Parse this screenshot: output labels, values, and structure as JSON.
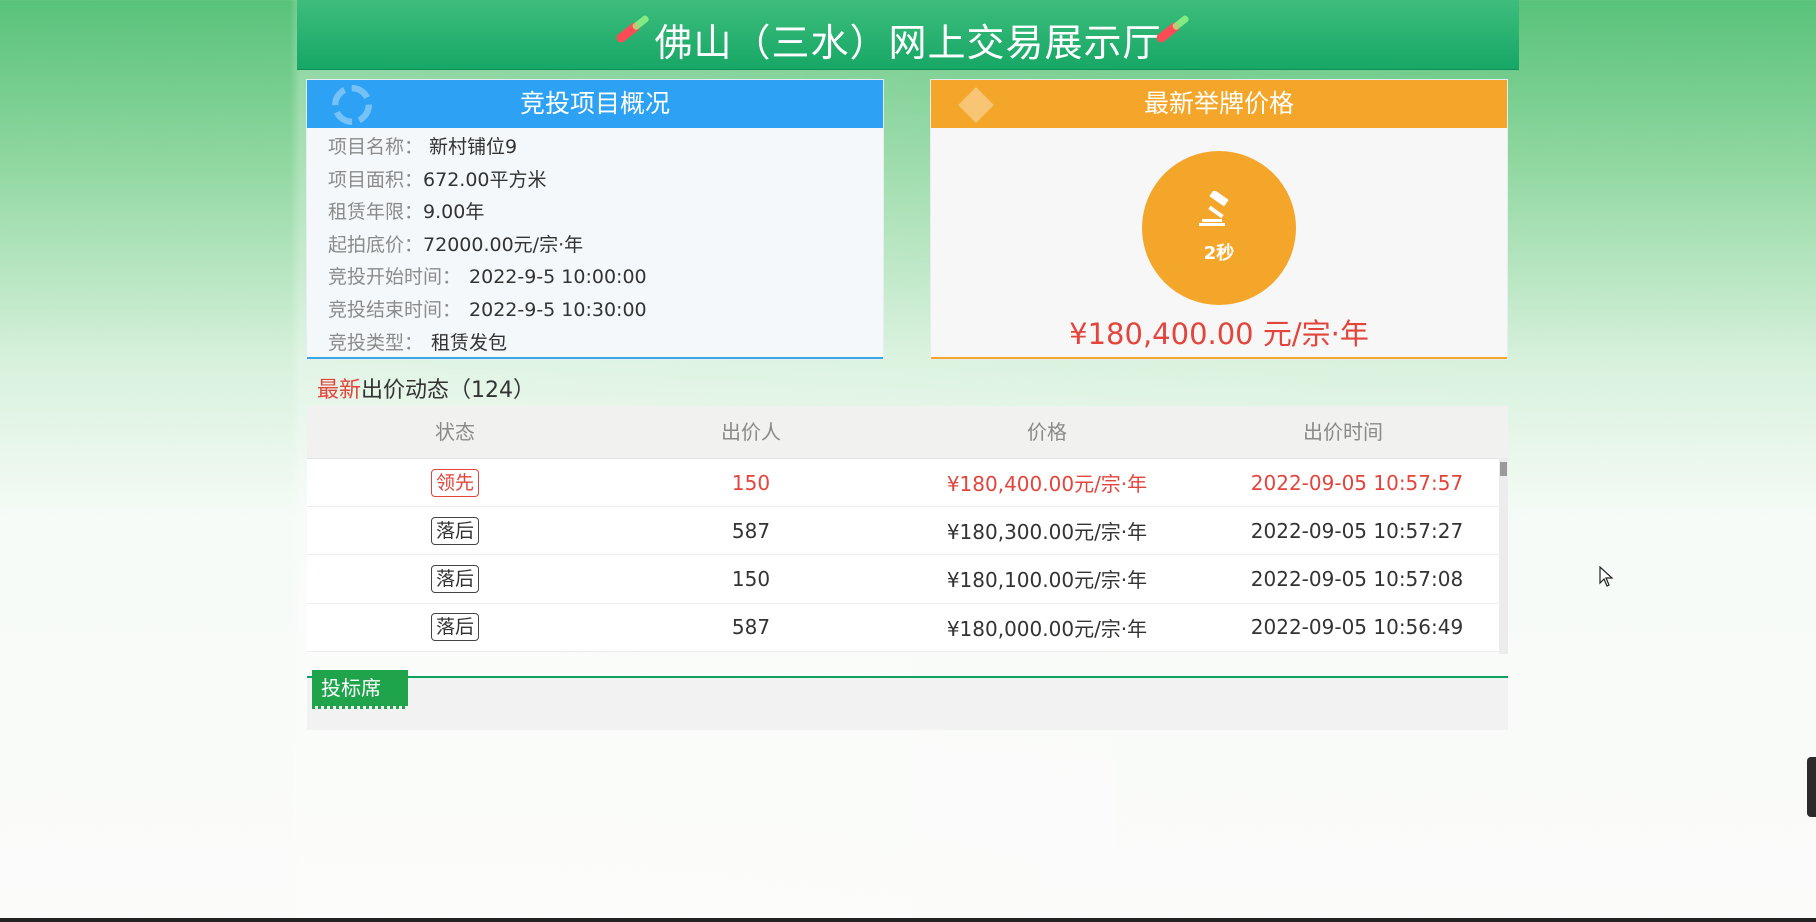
{
  "banner": {
    "title": "佛山（三水）网上交易展示厅"
  },
  "project": {
    "heading": "竞投项目概况",
    "rows": [
      {
        "label": "项目名称：",
        "value": "新村铺位9"
      },
      {
        "label": "项目面积：",
        "value": "672.00平方米"
      },
      {
        "label": "租赁年限：",
        "value": "9.00年"
      },
      {
        "label": "起拍底价：",
        "value": "72000.00元/宗·年"
      },
      {
        "label": "竞投开始时间：",
        "value": "2022-9-5 10:00:00"
      },
      {
        "label": "竞投结束时间：",
        "value": "2022-9-5 10:30:00"
      },
      {
        "label": "竞投类型：",
        "value": "租赁发包"
      }
    ]
  },
  "latest": {
    "heading": "最新举牌价格",
    "timer": "2秒",
    "price": "¥180,400.00 元/宗·年",
    "icon": "gavel-icon"
  },
  "dynamics": {
    "hot": "最新",
    "rest": "出价动态（124）"
  },
  "bids": {
    "columns": [
      "状态",
      "出价人",
      "价格",
      "出价时间"
    ],
    "rows": [
      {
        "status": "领先",
        "bidder": "150",
        "price": "¥180,400.00元/宗·年",
        "time": "2022-09-05 10:57:57",
        "leading": true
      },
      {
        "status": "落后",
        "bidder": "587",
        "price": "¥180,300.00元/宗·年",
        "time": "2022-09-05 10:57:27",
        "leading": false
      },
      {
        "status": "落后",
        "bidder": "150",
        "price": "¥180,100.00元/宗·年",
        "time": "2022-09-05 10:57:08",
        "leading": false
      },
      {
        "status": "落后",
        "bidder": "587",
        "price": "¥180,000.00元/宗·年",
        "time": "2022-09-05 10:56:49",
        "leading": false
      }
    ]
  },
  "seat": {
    "tab": "投标席"
  },
  "colors": {
    "banner": "#17a766",
    "blue": "#2da1f3",
    "orange": "#f4a62a",
    "red": "#e3453c",
    "green_tab": "#1fa44b"
  }
}
